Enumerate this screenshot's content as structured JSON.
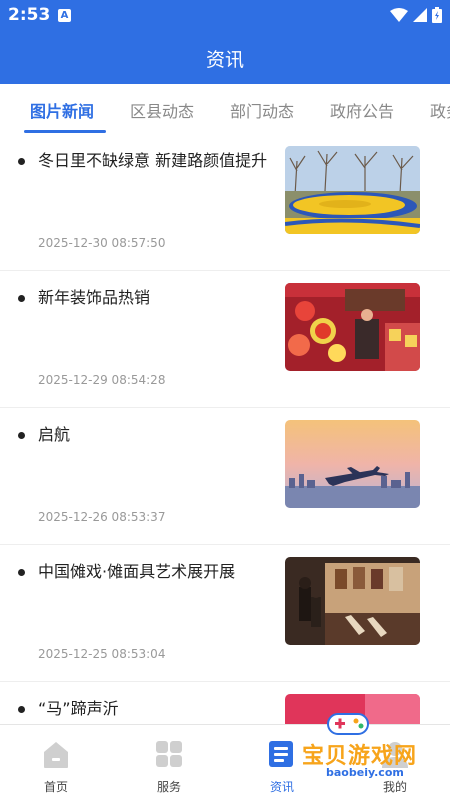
{
  "status_bar": {
    "time": "2:53",
    "notification_letter": "A"
  },
  "app_bar": {
    "title": "资讯"
  },
  "tabs": [
    {
      "label": "图片新闻",
      "active": true
    },
    {
      "label": "区县动态",
      "active": false
    },
    {
      "label": "部门动态",
      "active": false
    },
    {
      "label": "政府公告",
      "active": false
    },
    {
      "label": "政务",
      "active": false
    }
  ],
  "news": [
    {
      "title": "冬日里不缺绿意 新建路颜值提升",
      "date": "2025-12-30 08:57:50",
      "thumb": "park"
    },
    {
      "title": "新年装饰品热销",
      "date": "2025-12-29 08:54:28",
      "thumb": "market"
    },
    {
      "title": "启航",
      "date": "2025-12-26 08:53:37",
      "thumb": "airplane"
    },
    {
      "title": "中国傩戏·傩面具艺术展开展",
      "date": "2025-12-25 08:53:04",
      "thumb": "exhibition"
    },
    {
      "title": "“马”蹄声沂",
      "date": "",
      "thumb": "partial"
    }
  ],
  "bottom_nav": [
    {
      "label": "首页",
      "icon": "home-icon",
      "active": false
    },
    {
      "label": "服务",
      "icon": "grid-icon",
      "active": false
    },
    {
      "label": "资讯",
      "icon": "news-icon",
      "active": true
    },
    {
      "label": "我的",
      "icon": "user-icon",
      "active": false
    }
  ],
  "watermark": {
    "text": "宝贝游戏网",
    "url": "baobeiy.com"
  },
  "colors": {
    "primary": "#2f6fe3",
    "text": "#222222",
    "muted": "#999999"
  }
}
